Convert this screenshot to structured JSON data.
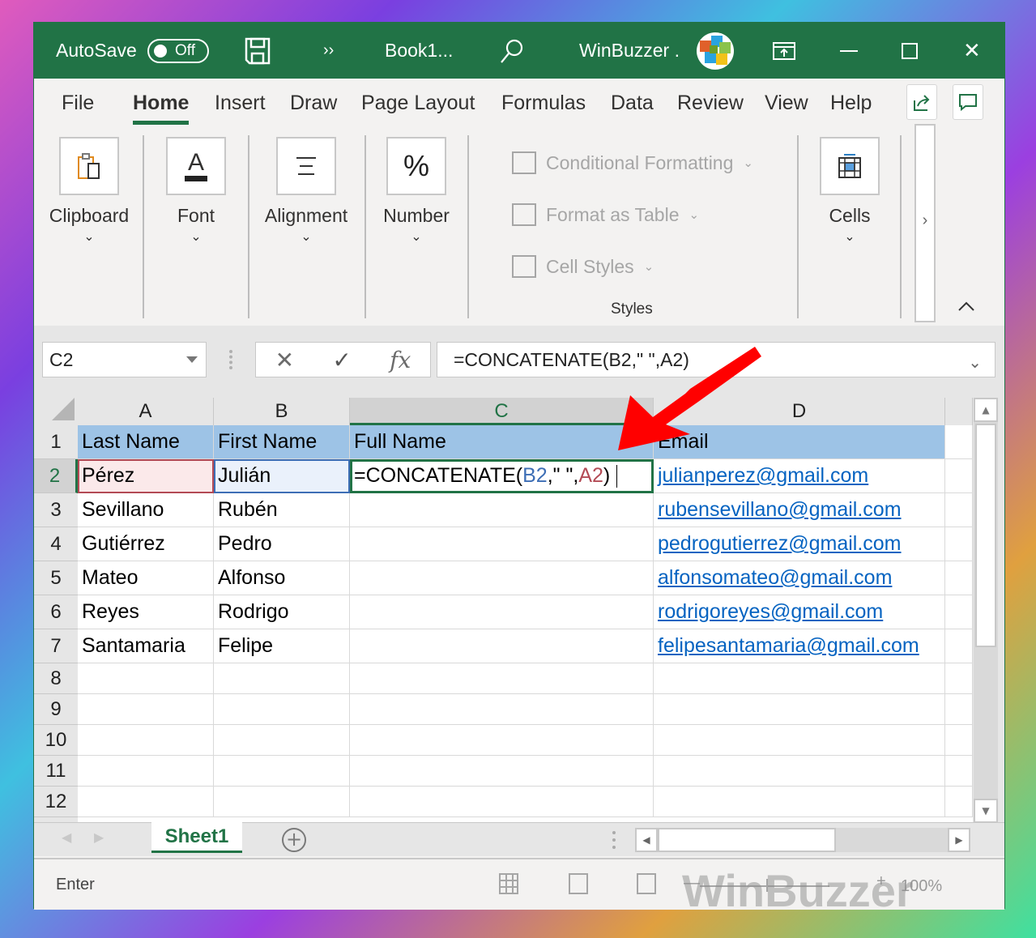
{
  "titlebar": {
    "autosave_label": "AutoSave",
    "autosave_state": "Off",
    "save_icon": "save-icon",
    "more_icon": "››",
    "document_title": "Book1...",
    "search_icon": "search-icon",
    "account_name": "WinBuzzer .",
    "ribbon_display_icon": "ribbon-display-options-icon",
    "minimize_icon": "—",
    "maximize_icon": "☐",
    "close_icon": "✕"
  },
  "menu": {
    "tabs": [
      "File",
      "Home",
      "Insert",
      "Draw",
      "Page Layout",
      "Formulas",
      "Data",
      "Review",
      "View",
      "Help"
    ],
    "active_tab": "Home",
    "share_icon": "share-icon",
    "comments_icon": "comments-icon"
  },
  "ribbon": {
    "groups": [
      {
        "label": "Clipboard",
        "icon": "clipboard-icon"
      },
      {
        "label": "Font",
        "icon": "font-icon",
        "glyph": "A"
      },
      {
        "label": "Alignment",
        "icon": "alignment-icon",
        "glyph": "☰"
      },
      {
        "label": "Number",
        "icon": "percent-icon",
        "glyph": "%"
      },
      {
        "label": "Cells",
        "icon": "cells-icon"
      }
    ],
    "styles": {
      "items": [
        "Conditional Formatting",
        "Format as Table",
        "Cell Styles"
      ],
      "label": "Styles"
    },
    "chevron_down": "⌄",
    "scroll_right": "›",
    "collapse_icon": "^"
  },
  "formula_bar": {
    "name_box": "C2",
    "cancel_icon": "✕",
    "enter_icon": "✓",
    "fx_label": "fx",
    "formula": "=CONCATENATE(B2,\" \",A2)"
  },
  "sheet": {
    "columns": [
      "A",
      "B",
      "C",
      "D"
    ],
    "selected_column": "C",
    "rows": [
      "1",
      "2",
      "3",
      "4",
      "5",
      "6",
      "7",
      "8",
      "9",
      "10",
      "11",
      "12"
    ],
    "selected_row": "2",
    "data": [
      [
        "Last Name",
        "First Name",
        "Full Name",
        "Email"
      ],
      [
        "Pérez",
        "Julián",
        "",
        "julianperez@gmail.com"
      ],
      [
        "Sevillano",
        "Rubén",
        "",
        "rubensevillano@gmail.com"
      ],
      [
        "Gutiérrez",
        "Pedro",
        "",
        "pedrogutierrez@gmail.com"
      ],
      [
        "Mateo",
        "Alfonso",
        "",
        "alfonsomateo@gmail.com"
      ],
      [
        "Reyes",
        "Rodrigo",
        "",
        "rodrigoreyes@gmail.com"
      ],
      [
        "Santamaria",
        "Felipe",
        "",
        "felipesantamaria@gmail.com"
      ]
    ],
    "editing_formula": {
      "prefix": "=CONCATENATE(",
      "ref1": "B2",
      "middle": ",\" \",",
      "ref2": "A2",
      "suffix": ")"
    }
  },
  "sheet_tabs": {
    "tabs": [
      "Sheet1"
    ],
    "add_icon": "+"
  },
  "statusbar": {
    "mode": "Enter",
    "zoom": "100%",
    "zoom_minus": "—",
    "zoom_plus": "+"
  },
  "annotation": {
    "arrow_color": "#ff0000"
  },
  "watermark": "WinBuzzer"
}
